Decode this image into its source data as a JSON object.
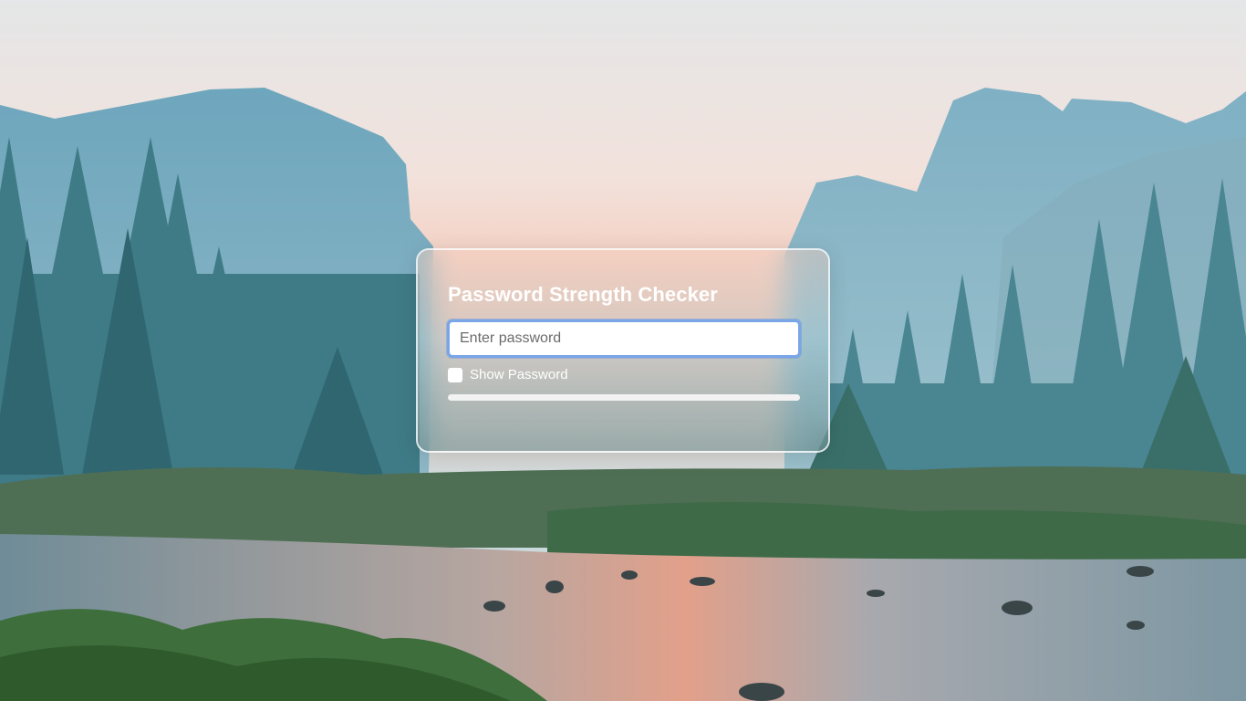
{
  "page": {
    "title": "Password Strength Checker"
  },
  "form": {
    "password_placeholder": "Enter password",
    "password_value": "",
    "show_password_label": "Show Password",
    "show_password_checked": false
  },
  "strength_meter": {
    "level": 0
  },
  "colors": {
    "accent_focus": "#7aa6e8",
    "text_light": "#ffffff"
  }
}
